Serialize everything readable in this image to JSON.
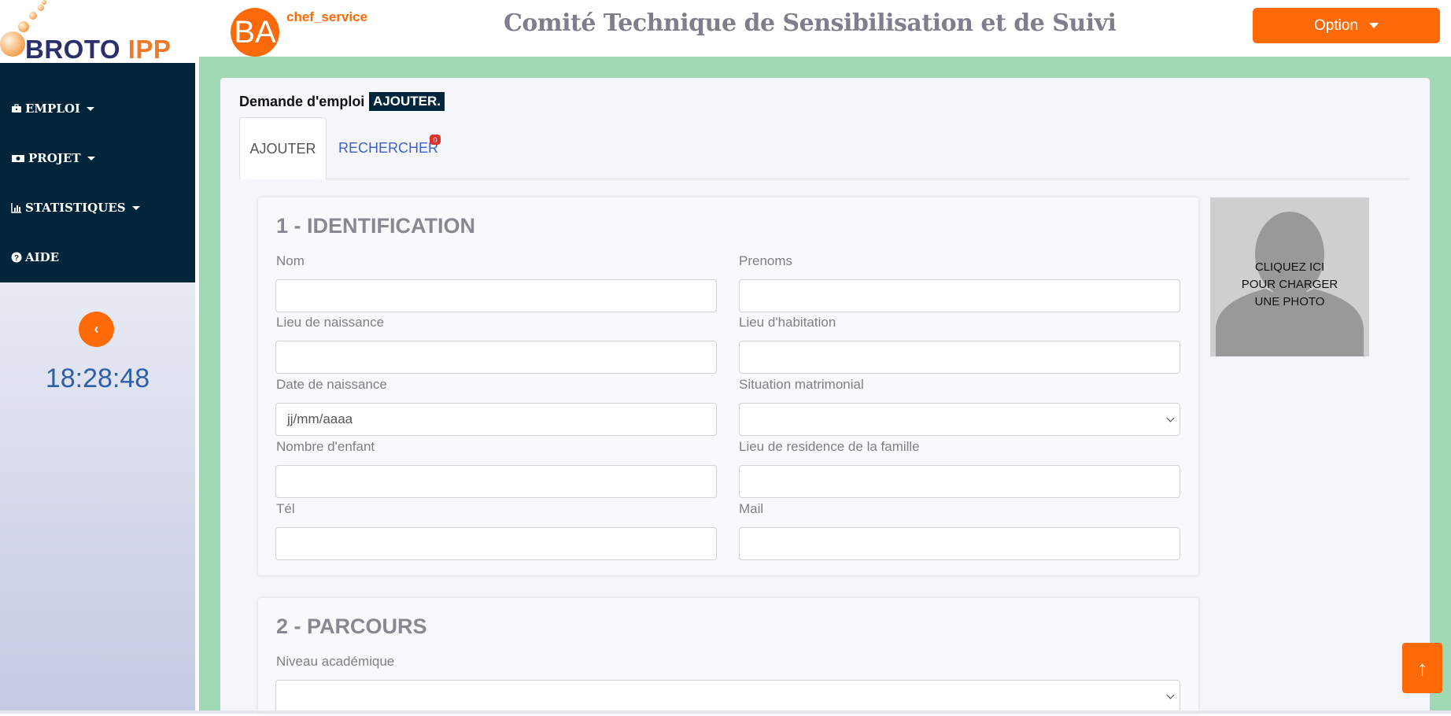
{
  "header": {
    "logo_brand": "BROTO",
    "logo_suffix": "IPP",
    "avatar_initials": "BA",
    "username": "chef_service",
    "title": "Comité Technique de Sensibilisation et de Suivi",
    "option_label": "Option"
  },
  "sidebar": {
    "items": [
      {
        "label": "EMPLOI",
        "icon": "briefcase-icon",
        "has_caret": true
      },
      {
        "label": "PROJET",
        "icon": "money-icon",
        "has_caret": true
      },
      {
        "label": "STATISTIQUES",
        "icon": "chart-icon",
        "has_caret": true
      },
      {
        "label": "AIDE",
        "icon": "question-icon",
        "has_caret": false
      }
    ],
    "clock": "18:28:48"
  },
  "page": {
    "breadcrumb": "Demande d'emploi",
    "breadcrumb_badge": "AJOUTER.",
    "tabs": [
      {
        "label": "AJOUTER",
        "active": true
      },
      {
        "label": "RECHERCHER",
        "active": false,
        "badge": "0"
      }
    ]
  },
  "identification": {
    "title": "1 - IDENTIFICATION",
    "fields": {
      "nom": {
        "label": "Nom",
        "value": ""
      },
      "prenoms": {
        "label": "Prenoms",
        "value": ""
      },
      "lieu_naissance": {
        "label": "Lieu de naissance",
        "value": ""
      },
      "lieu_habitation": {
        "label": "Lieu d'habitation",
        "value": ""
      },
      "date_naissance": {
        "label": "Date de naissance",
        "placeholder": "jj/mm/aaaa"
      },
      "situation": {
        "label": "Situation matrimonial",
        "value": ""
      },
      "nombre_enfant": {
        "label": "Nombre d'enfant",
        "value": ""
      },
      "lieu_residence": {
        "label": "Lieu de residence de la famille",
        "value": ""
      },
      "tel": {
        "label": "Tél",
        "value": ""
      },
      "mail": {
        "label": "Mail",
        "value": ""
      }
    }
  },
  "photo": {
    "line1": "CLIQUEZ ICI",
    "line2": "POUR CHARGER",
    "line3": "UNE PHOTO"
  },
  "parcours": {
    "title": "2 - PARCOURS",
    "niveau_label": "Niveau académique"
  },
  "colors": {
    "accent": "#fd6a07",
    "sidebar": "#01253a",
    "main_bg": "#a0d9b4",
    "link": "#3e60c9"
  }
}
